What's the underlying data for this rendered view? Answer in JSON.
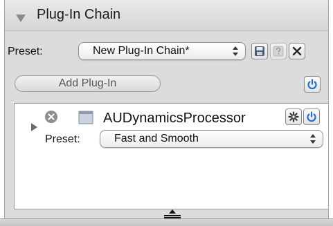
{
  "header": {
    "title": "Plug-In Chain",
    "disclosure_icon": "disclosure-triangle-down-icon"
  },
  "preset": {
    "label": "Preset:",
    "value": "New Plug-In Chain*",
    "save_icon": "floppy-disk-icon",
    "help_icon": "question-mark-icon",
    "close_icon": "x-close-icon"
  },
  "toolbar": {
    "add_plugin_label": "Add Plug-In",
    "power_icon": "power-icon"
  },
  "plugin": {
    "name": "AUDynamicsProcessor",
    "remove_icon": "remove-circle-icon",
    "window_icon": "plugin-window-icon",
    "settings_icon": "gear-icon",
    "power_icon": "power-icon",
    "preset_label": "Preset:",
    "preset_value": "Fast and Smooth"
  },
  "colors": {
    "power_blue": "#1f6fd6"
  },
  "resize_icon": "resize-handle-icon"
}
